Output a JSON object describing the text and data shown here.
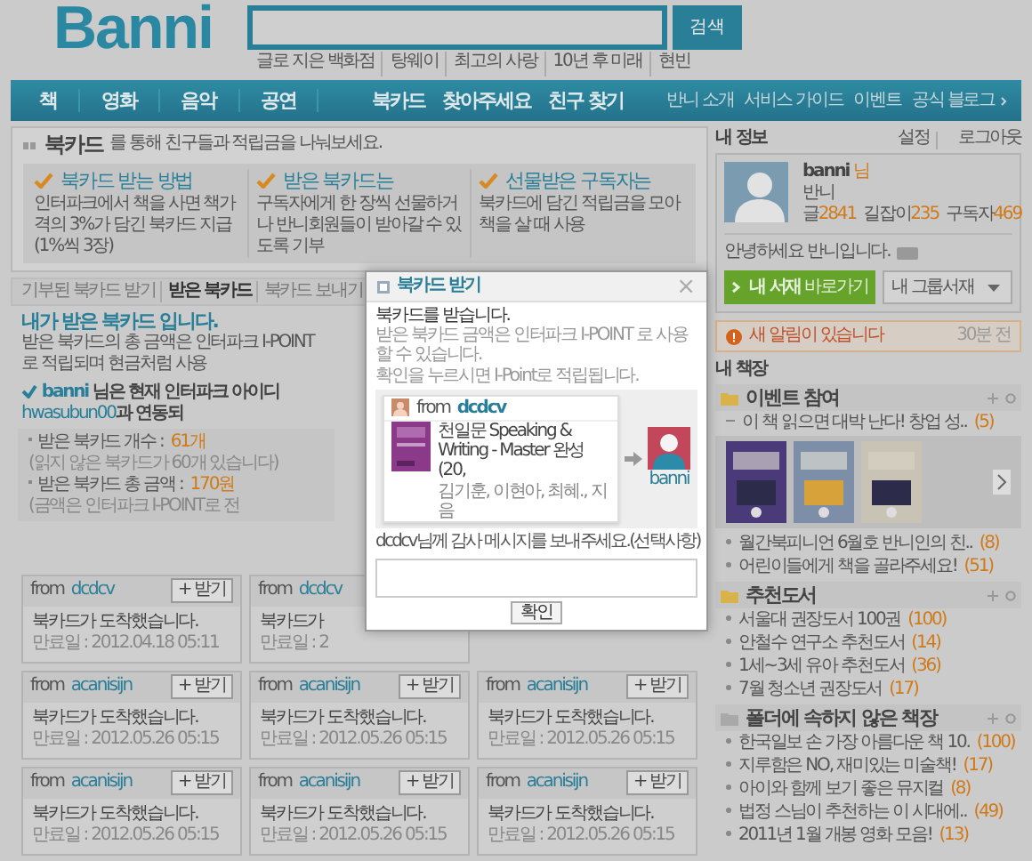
{
  "header": {
    "logo": "Banni",
    "search_button": "검색"
  },
  "popular_searches": [
    "글로 지은 백화점",
    "탕웨이",
    "최고의 사랑",
    "10년 후 미래",
    "현빈"
  ],
  "nav": {
    "categories": [
      "책",
      "영화",
      "음악",
      "공연"
    ],
    "features": [
      "북카드",
      "찾아주세요",
      "친구 찾기"
    ],
    "links": [
      "반니 소개",
      "서비스 가이드",
      "이벤트",
      "공식 블로그"
    ]
  },
  "intro": {
    "title": "북카드",
    "subtitle": "를 통해 친구들과 적립금을 나눠보세요.",
    "steps": [
      {
        "title": "북카드 받는 방법",
        "text": "인터파크에서 책을 사면 책가격의 3%가 담긴 북카드 지급(1%씩 3장)"
      },
      {
        "title": "받은 북카드는",
        "text": "구독자에게 한 장씩 선물하거나 반니회원들이 받아갈 수 있도록 기부"
      },
      {
        "title": "선물받은 구독자는",
        "text": "북카드에 담긴 적립금을 모아 책을 살 때 사용"
      }
    ]
  },
  "tabs": [
    {
      "label": "기부된 북카드 받기",
      "selected": false
    },
    {
      "label": "받은 북카드",
      "selected": true
    },
    {
      "label": "북카드 보내기",
      "selected": false
    }
  ],
  "received": {
    "heading": "내가 받은 북카드 입니다.",
    "note": "받은 북카드의 총 금액은 인터파크 I-POINT 로 적립되며 현금처럼 사용",
    "notice": {
      "user": "banni",
      "text": "님은 현재 인터파크 아이디",
      "account": "hwasubun00",
      "tail": "과 연동되"
    },
    "stats": [
      {
        "label": "받은 북카드 개수 :",
        "value": "61개",
        "note": "(읽지 않은 북카드가 60개 있습니다)"
      },
      {
        "label": "받은 북카드 총 금액 :",
        "value": "170원",
        "note": "(금액은 인터파크 I-POINT로 전"
      }
    ]
  },
  "card_rows": [
    [
      {
        "from_label": "from",
        "from": "dcdcv",
        "button": "+ 받기",
        "message": "북카드가 도착했습니다.",
        "expiry": "만료일 : 2012.04.18 05:11"
      },
      {
        "from_label": "from",
        "from": "dcdcv",
        "message": "북카드가",
        "expiry": "만료일 : 2"
      }
    ],
    [
      {
        "from_label": "from",
        "from": "acanisijn",
        "button": "+ 받기",
        "message": "북카드가 도착했습니다.",
        "expiry": "만료일 : 2012.05.26 05:15"
      },
      {
        "from_label": "from",
        "from": "acanisijn",
        "button": "+ 받기",
        "message": "북카드가 도착했습니다.",
        "expiry": "만료일 : 2012.05.26 05:15"
      },
      {
        "from_label": "from",
        "from": "acanisijn",
        "button": "+ 받기",
        "message": "북카드가 도착했습니다.",
        "expiry": "만료일 : 2012.05.26 05:15"
      }
    ],
    [
      {
        "from_label": "from",
        "from": "acanisijn",
        "button": "+ 받기",
        "message": "북카드가 도착했습니다.",
        "expiry": "만료일 : 2012.05.26 05:15"
      },
      {
        "from_label": "from",
        "from": "acanisijn",
        "button": "+ 받기",
        "message": "북카드가 도착했습니다.",
        "expiry": "만료일 : 2012.05.26 05:15"
      },
      {
        "from_label": "from",
        "from": "acanisijn",
        "button": "+ 받기",
        "message": "북카드가 도착했습니다.",
        "expiry": "만료일 : 2012.05.26 05:15"
      }
    ]
  ],
  "sidebar": {
    "title": "내 정보",
    "settings": "설정",
    "logout": "로그아웃",
    "profile": {
      "name": "banni",
      "suffix": "님",
      "nickname": "반니",
      "stats": [
        {
          "label": "글",
          "value": "2841"
        },
        {
          "label": "길잡이",
          "value": "235"
        },
        {
          "label": "구독자",
          "value": "469"
        }
      ],
      "greeting": "안녕하세요 반니입니다.",
      "library_button": "**내 서재** 바로가기",
      "group_select": "내 그룹서재"
    },
    "alert": {
      "text": "새 알림이 있습니다",
      "time": "30분 전"
    },
    "shelf_title": "내 책장",
    "folders": [
      {
        "kind": "folder",
        "name": "이벤트 참여",
        "items": [
          {
            "title": "이 책 읽으면 대박 난다! 창업 성..",
            "count": "(5)",
            "expanded": true
          },
          {
            "title": "월간북피니언 6월호 반니인의 친..",
            "count": "(8)",
            "expanded": false
          },
          {
            "title": "어린이들에게 책을 골라주세요!",
            "count": "(51)",
            "expanded": false
          }
        ]
      },
      {
        "kind": "folder",
        "name": "추천도서",
        "items": [
          {
            "title": "서울대 권장도서 100권",
            "count": "(100)",
            "expanded": false
          },
          {
            "title": "안철수 연구소 추천도서",
            "count": "(14)",
            "expanded": false
          },
          {
            "title": "1세~3세 유아 추천도서",
            "count": "(36)",
            "expanded": false
          },
          {
            "title": "7월 청소년 권장도서",
            "count": "(17)",
            "expanded": false
          }
        ]
      },
      {
        "kind": "unfiled",
        "name": "폴더에 속하지 않은 책장",
        "items": [
          {
            "title": "한국일보 손 가장 아름다운 책 10.",
            "count": "(100)",
            "expanded": false
          },
          {
            "title": "지루함은 NO, 재미있는 미술책!",
            "count": "(17)",
            "expanded": false
          },
          {
            "title": "아이와 함께 보기 좋은 뮤지컬",
            "count": "(8)",
            "expanded": false
          },
          {
            "title": "법정 스님이 추천하는 이 시대에..",
            "count": "(49)",
            "expanded": false
          },
          {
            "title": "2011년 1월 개봉 영화 모음!",
            "count": "(13)",
            "expanded": false
          }
        ]
      }
    ]
  },
  "modal": {
    "title": "북카드 받기",
    "close": "×",
    "lead": "북카드를 받습니다.",
    "notes": [
      "받은 북카드 금액은 인터파크 I-POINT 로 사용할 수 있습니다.",
      "확인을 누르시면 I-Point로 적립됩니다."
    ],
    "gift": {
      "from_label": "from",
      "from": "dcdcv",
      "book_title": "천일문 Speaking & Writing - Master 완성 (20,",
      "book_author": "김기훈, 이현아, 최혜., 지음",
      "to": "banni"
    },
    "message_label": "dcdcv님께 감사 메시지를 보내주세요.(선택사항)",
    "confirm": "확인"
  }
}
